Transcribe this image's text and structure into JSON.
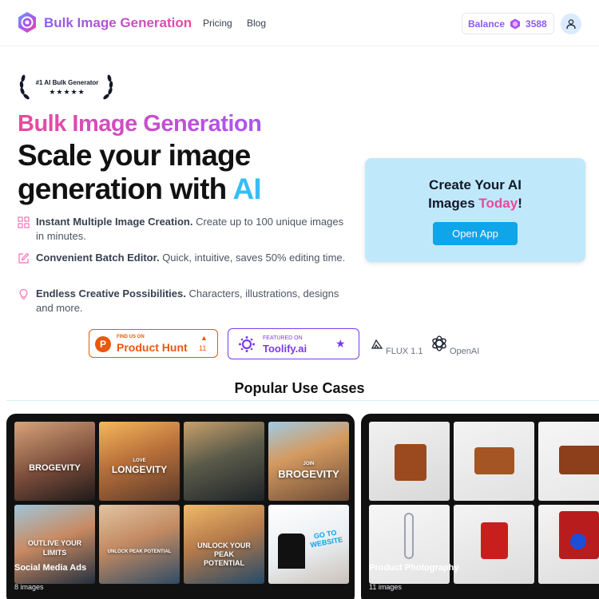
{
  "header": {
    "brand": "Bulk Image Generation",
    "nav": [
      "Pricing",
      "Blog"
    ],
    "balance_label": "Balance",
    "balance_value": "3588"
  },
  "hero": {
    "award_title": "#1 AI Bulk Generator",
    "award_stars": "★★★★★",
    "kicker": "Bulk Image Generation",
    "title_line1": "Scale your image",
    "title_line2_prefix": "generation with ",
    "title_accent": "AI",
    "features": [
      {
        "bold": "Instant Multiple Image Creation.",
        "text": " Create up to 100 unique images in minutes.",
        "icon": "grid-icon"
      },
      {
        "bold": "Convenient Batch Editor.",
        "text": " Quick, intuitive, saves 50% editing time.",
        "icon": "edit-icon"
      },
      {
        "bold": "Endless Creative Possibilities.",
        "text": " Characters, illustrations, designs and more.",
        "icon": "lightbulb-icon"
      }
    ]
  },
  "cta": {
    "title_line1": "Create Your AI",
    "title_line2_prefix": "Images ",
    "title_highlight": "Today",
    "title_suffix": "!",
    "button": "Open App"
  },
  "badges": {
    "producthunt_small": "FIND US ON",
    "producthunt_big": "Product Hunt",
    "producthunt_logo": "P",
    "producthunt_arrow": "▲",
    "producthunt_count": "11",
    "toolify_small": "FEATURED ON",
    "toolify_big": "Toolify.ai",
    "toolify_star": "★",
    "flux": "FLUX 1.1",
    "openai": "OpenAI"
  },
  "use_cases": {
    "title": "Popular Use Cases",
    "cards": [
      {
        "title": "Social Media Ads",
        "count": "8 images",
        "captions": [
          "BROGEVITY",
          "LONGEVITY",
          "",
          "BROGEVITY",
          "OUTLIVE YOUR LIMITS",
          "UNLOCK PEAK POTENTIAL",
          "UNLOCK YOUR PEAK POTENTIAL",
          "GO TO WEBSITE"
        ],
        "subcaptions": [
          "",
          "LOVE",
          "",
          "JOIN",
          "",
          "",
          "",
          ""
        ]
      },
      {
        "title": "Product Photography",
        "count": "11 images"
      }
    ]
  },
  "colors": {
    "brand_gradient_start": "#8b5cf6",
    "brand_gradient_end": "#ec4899",
    "accent_blue": "#38bdf8",
    "cta_bg": "#bfe9fb",
    "cta_button": "#0ea5e9",
    "producthunt": "#ea580c",
    "toolify": "#7c3aed"
  }
}
